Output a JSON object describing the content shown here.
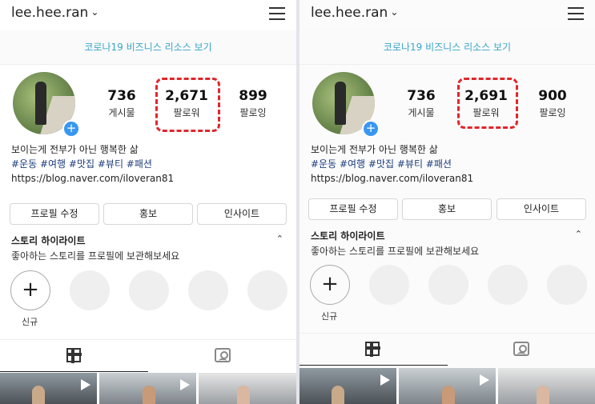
{
  "screens": [
    {
      "username": "lee.hee.ran",
      "banner": "코로나19 비즈니스 리소스 보기",
      "stats": [
        {
          "value": "736",
          "label": "게시물"
        },
        {
          "value": "2,671",
          "label": "팔로워"
        },
        {
          "value": "899",
          "label": "팔로잉"
        }
      ],
      "bio": {
        "line1": "보이는게 전부가 아닌 행복한 삶",
        "tags": "#운동 #여행 #맛집 #뷰티 #패션",
        "link": "https://blog.naver.com/iloveran81"
      },
      "buttons": [
        "프로필 수정",
        "홍보",
        "인사이트"
      ],
      "highlights": {
        "title": "스토리 하이라이트",
        "subtitle": "좋아하는 스토리를 프로필에 보관해보세요",
        "new_label": "신규"
      }
    },
    {
      "username": "lee.hee.ran",
      "banner": "코로나19 비즈니스 리소스 보기",
      "stats": [
        {
          "value": "736",
          "label": "게시물"
        },
        {
          "value": "2,691",
          "label": "팔로워"
        },
        {
          "value": "900",
          "label": "팔로잉"
        }
      ],
      "bio": {
        "line1": "보이는게 전부가 아닌 행복한 삶",
        "tags": "#운동 #여행 #맛집 #뷰티 #패션",
        "link": "https://blog.naver.com/iloveran81"
      },
      "buttons": [
        "프로필 수정",
        "홍보",
        "인사이트"
      ],
      "highlights": {
        "title": "스토리 하이라이트",
        "subtitle": "좋아하는 스토리를 프로필에 보관해보세요",
        "new_label": "신규"
      }
    }
  ],
  "colors": {
    "accent": "#3897f0",
    "highlight_box": "#e0262c",
    "banner_text": "#3aa5c9"
  },
  "icons": [
    "chevron-down-icon",
    "menu-icon",
    "plus-icon",
    "caret-up-icon",
    "grid-icon",
    "tagged-icon",
    "play-icon"
  ]
}
